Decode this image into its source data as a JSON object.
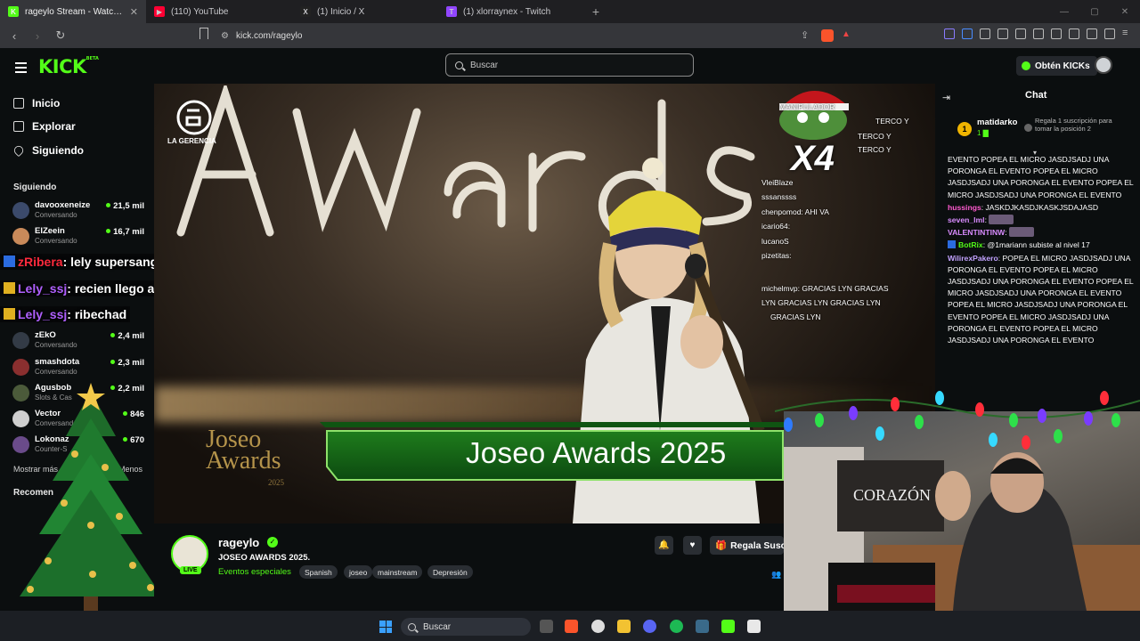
{
  "browser": {
    "tabs": [
      {
        "title": "rageylo Stream - Watch Live",
        "active": true,
        "color": "#53fc18",
        "glyph": "K"
      },
      {
        "title": "(110) YouTube",
        "active": false,
        "color": "#ff0033",
        "glyph": "▶"
      },
      {
        "title": "(1) Inicio / X",
        "active": false,
        "color": "#222222",
        "glyph": "X"
      },
      {
        "title": "(1) xlorraynex - Twitch",
        "active": false,
        "color": "#9146ff",
        "glyph": "T"
      }
    ],
    "url": "kick.com/rageylo"
  },
  "header": {
    "logo": "KICK",
    "logo_sup": "BETA",
    "search_placeholder": "Buscar",
    "kicks_button": "Obtén KICKs"
  },
  "sidebar": {
    "nav": [
      {
        "label": "Inicio",
        "icon": "home-icon"
      },
      {
        "label": "Explorar",
        "icon": "compass-icon"
      },
      {
        "label": "Siguiendo",
        "icon": "heart-icon"
      }
    ],
    "following_title": "Siguiendo",
    "channels": [
      {
        "name": "davooxeneize",
        "sub": "Conversando",
        "viewers": "21,5 mil",
        "color": "#3b4a6b"
      },
      {
        "name": "ElZeein",
        "sub": "Conversando",
        "viewers": "16,7 mil",
        "color": "#c98a5a"
      },
      {
        "name": "zEkO",
        "sub": "Conversando",
        "viewers": "2,4 mil",
        "color": "#333b46"
      },
      {
        "name": "smashdota",
        "sub": "Conversando",
        "viewers": "2,3 mil",
        "color": "#8a2f2f"
      },
      {
        "name": "Agusbob",
        "sub": "Slots & Cas",
        "viewers": "2,2 mil",
        "color": "#4b5a3a"
      },
      {
        "name": "Vector",
        "sub": "Conversando",
        "viewers": "846",
        "color": "#cfcfcf"
      },
      {
        "name": "Lokonaz",
        "sub": "Counter-S",
        "viewers": "670",
        "color": "#6a4b8a"
      }
    ],
    "show_more": "Mostrar más",
    "show_less": "Menos",
    "recommended_title": "Recomen",
    "overlay_chat": [
      {
        "user": "zRibera",
        "text": ": lely supersangrejuvenil"
      },
      {
        "user": "Lely_ssj",
        "text": ": recien llego a mi house"
      },
      {
        "user": "Lely_ssj",
        "text": ": ribechad"
      }
    ]
  },
  "video": {
    "brand": "LA GERENCIA",
    "banner_title": "Joseo Awards 2025",
    "logo_line1": "Joseo",
    "logo_line2": "Awards",
    "logo_year": "2025",
    "multiplier": "X4",
    "overlay_chat": [
      "MANIPULADOR",
      "TERCO Y",
      "TERCO Y",
      "TERCO Y",
      "VleiBlaze",
      "sssanssss",
      "chenpomod: AHI VA",
      "icario64:",
      "lucanoS",
      "pizetitas:",
      "michelmvp: GRACIAS LYN   GRACIAS",
      "LYN   GRACIAS LYN   GRACIAS LYN",
      "GRACIAS LYN"
    ]
  },
  "stream": {
    "streamer": "rageylo",
    "live": "LIVE",
    "title": "JOSEO AWARDS 2025.",
    "category": "Eventos especiales",
    "tags": [
      "Spanish",
      "joseo",
      "mainstream",
      "Depresión"
    ],
    "gift_button": "Regala Susc"
  },
  "chat": {
    "title": "Chat",
    "pinned_user": "matidarko",
    "pinned_rank": "1",
    "pinned_count": "1",
    "pinned_info": "Regala 1 suscripción para tomar la posición 2",
    "messages": [
      {
        "user": "",
        "text": "EVENTO  POPEA EL MICRO JASDJSADJ UNA PORONGA EL EVENTO  POPEA EL MICRO JASDJSADJ UNA PORONGA EL EVENTO  POPEA EL MICRO JASDJSADJ UNA PORONGA EL EVENTO"
      },
      {
        "user": "hussings",
        "text": ": JASKDJKASDJKASKJSDAJASD"
      },
      {
        "user": "seven_lml",
        "text": ":"
      },
      {
        "user": "VALENTINTINW",
        "text": ":"
      },
      {
        "user": "BotRix",
        "text": ": @1mariann subiste al nivel 17"
      },
      {
        "user": "WilirexPakero",
        "text": ": POPEA EL MICRO JASDJSADJ UNA PORONGA EL EVENTO  POPEA EL MICRO JASDJSADJ UNA PORONGA EL EVENTO  POPEA EL MICRO JASDJSADJ UNA PORONGA EL EVENTO  POPEA EL MICRO JASDJSADJ UNA PORONGA EL EVENTO  POPEA EL MICRO JASDJSADJ UNA PORONGA EL EVENTO  POPEA EL MICRO JASDJSADJ UNA PORONGA EL EVENTO"
      }
    ]
  },
  "taskbar": {
    "search": "Buscar"
  }
}
